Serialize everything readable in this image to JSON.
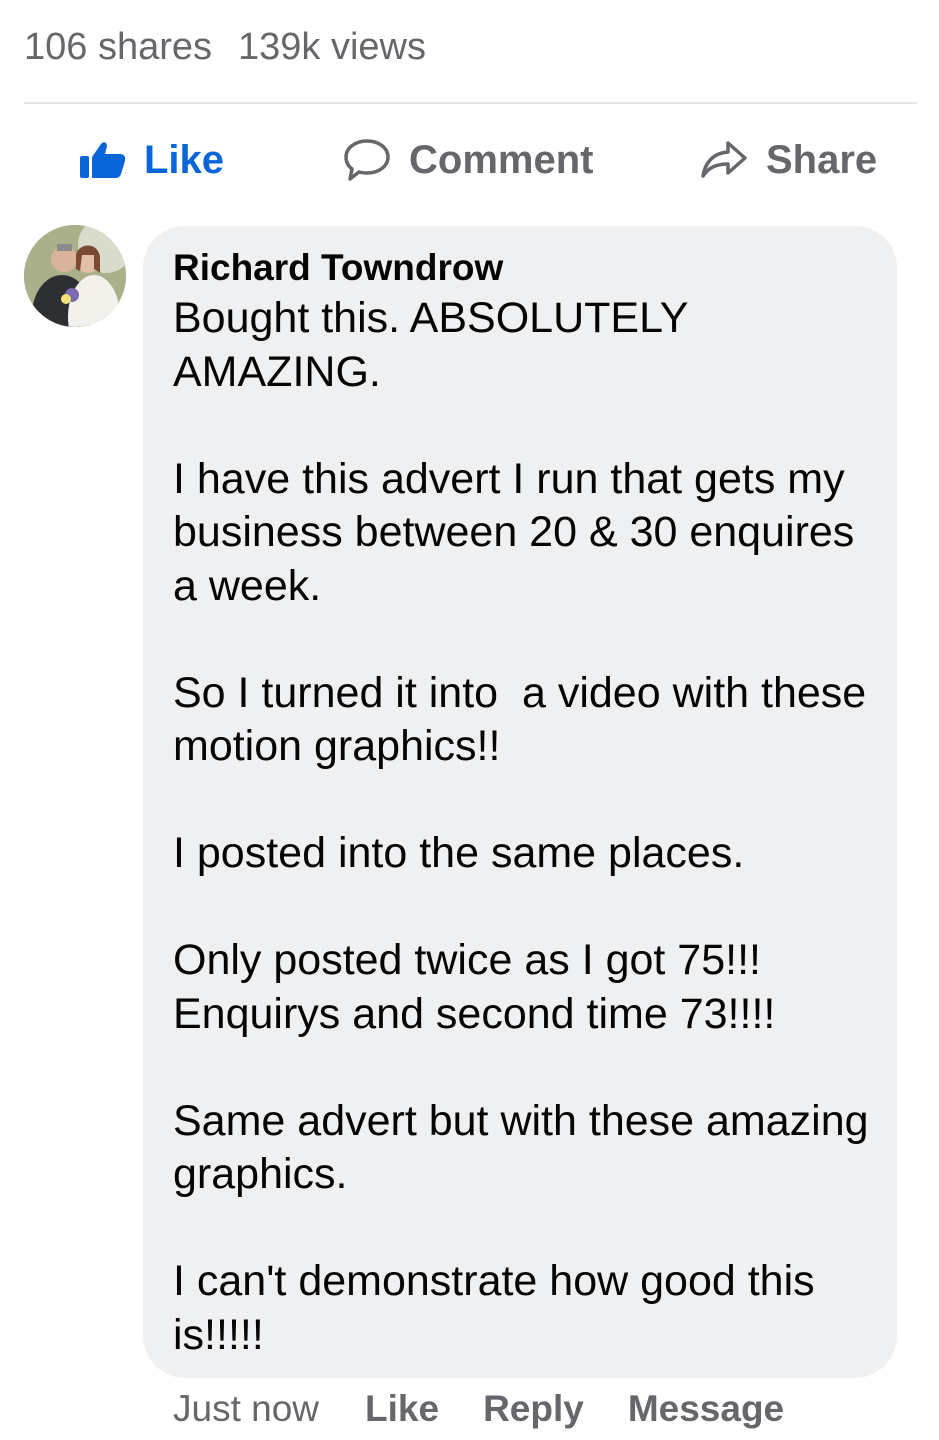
{
  "post_stats": {
    "shares": "106 shares",
    "views": "139k views"
  },
  "actions": {
    "like": "Like",
    "comment": "Comment",
    "share": "Share"
  },
  "comment": {
    "author": "Richard Towndrow",
    "paragraphs": [
      "Bought this. ABSOLUTELY AMAZING.",
      "I have this advert I run that gets my business between 20 & 30 enquires a week.",
      "So I turned it into  a video with these motion graphics!!",
      "I posted into the same places.",
      "Only posted twice as I got 75!!! Enquirys and second time 73!!!!",
      "Same advert but with these amazing graphics.",
      "I can't demonstrate how good this is!!!!!"
    ],
    "time": "Just now",
    "like_label": "Like",
    "reply_label": "Reply",
    "message_label": "Message"
  },
  "colors": {
    "accent": "#0a66d8",
    "muted_text": "#65676b",
    "bubble": "#eff0f2"
  }
}
